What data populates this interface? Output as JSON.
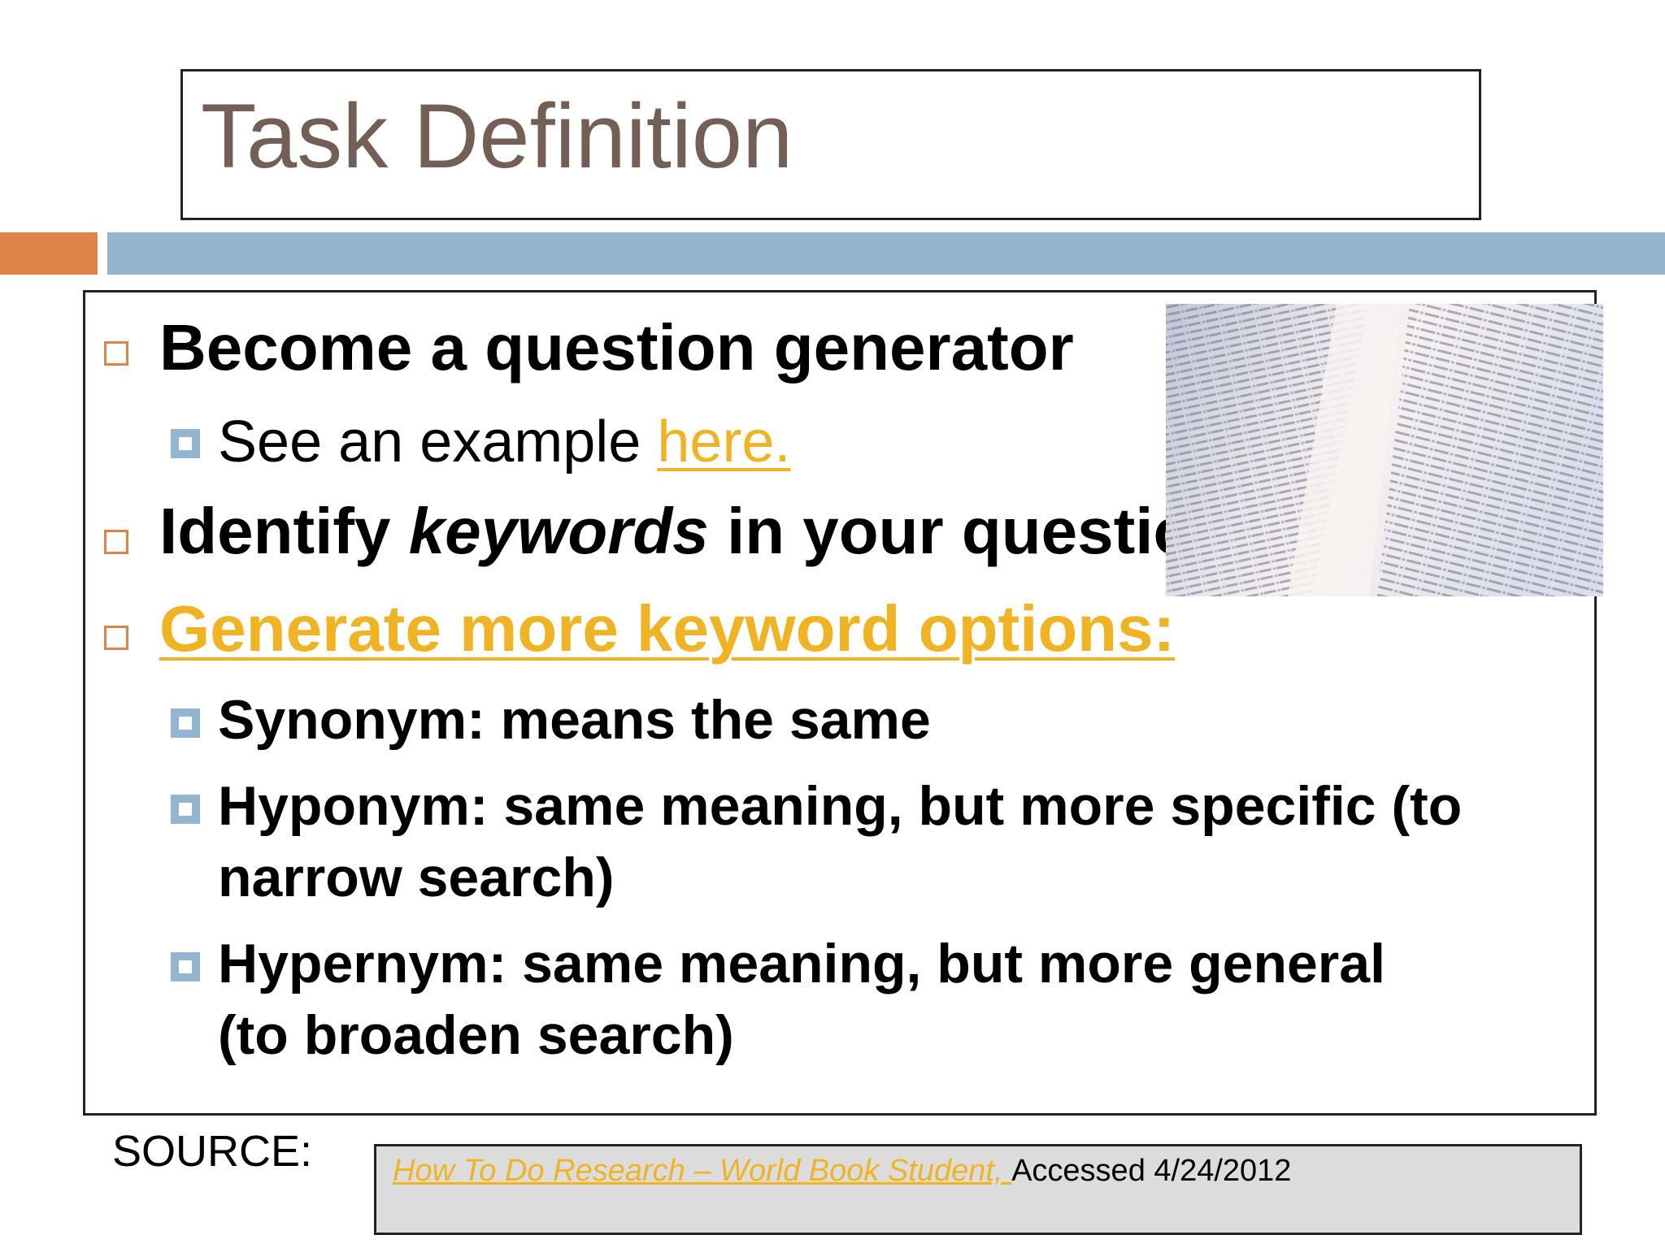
{
  "slide": {
    "title": "Task Definition",
    "bullets": {
      "b1": "Become a question generator",
      "b1_sub_prefix": "See an example ",
      "b1_sub_link": "here.",
      "b2_pre": "Identify ",
      "b2_em": "keywords",
      "b2_post": " in your question",
      "b3_link": "Generate more keyword options:",
      "b3_sub1": "Synonym: means the same",
      "b3_sub2_line1": "Hyponym: same meaning, but more specific (to",
      "b3_sub2_line2": "narrow search)",
      "b3_sub3_line1": "Hypernym: same meaning, but more general",
      "b3_sub3_line2": "(to broaden search)"
    },
    "source": {
      "label": "SOURCE:",
      "link": "How To Do Research – World Book Student, ",
      "accessed": "Accessed 4/24/2012"
    }
  },
  "colors": {
    "title": "#735f55",
    "accent_orange": "#dd8449",
    "accent_blue": "#94b5cf",
    "link": "#f0b323",
    "source_bg": "#dcdcdc"
  },
  "icons": {
    "level1_bullet": "hollow-square-orange",
    "level2_bullet": "square-blue-white-center"
  }
}
